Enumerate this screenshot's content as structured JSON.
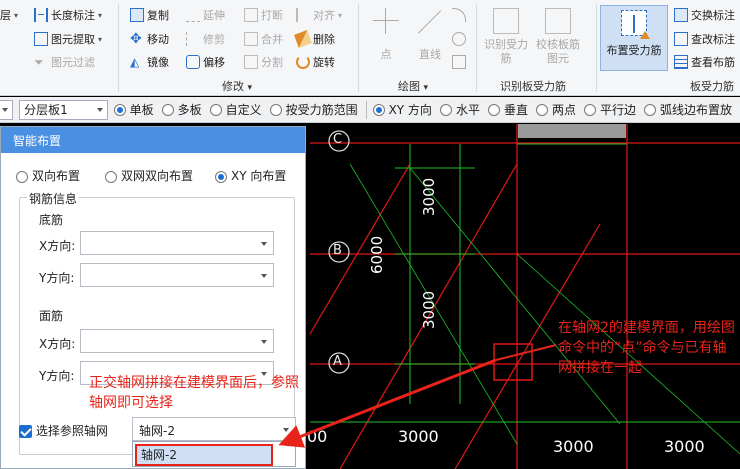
{
  "ribbon": {
    "left_items": [
      "层",
      "长度标注",
      "图元提取",
      "图元过滤"
    ],
    "modify_items": [
      "复制",
      "延伸",
      "打断",
      "对齐",
      "移动",
      "修剪",
      "合并",
      "删除",
      "镜像",
      "偏移",
      "分割",
      "旋转"
    ],
    "modify_label": "修改",
    "draw_items": [
      "点",
      "直线"
    ],
    "draw_label": "绘图",
    "identify_items": [
      "识别受力筋",
      "校核板筋图元"
    ],
    "identify_label": "识别板受力筋",
    "place_button": "布置受力筋",
    "rebar_items": [
      "交换标注",
      "查改标注",
      "查看布筋"
    ],
    "rebar_label": "板受力筋"
  },
  "optbar": {
    "layer_value": "分层板1",
    "options": [
      {
        "label": "单板",
        "selected": true
      },
      {
        "label": "多板",
        "selected": false
      },
      {
        "label": "自定义",
        "selected": false
      },
      {
        "label": "按受力筋范围",
        "selected": false
      },
      {
        "label": "XY 方向",
        "selected": true
      },
      {
        "label": "水平",
        "selected": false
      },
      {
        "label": "垂直",
        "selected": false
      },
      {
        "label": "两点",
        "selected": false
      },
      {
        "label": "平行边",
        "selected": false
      },
      {
        "label": "弧线边布置放",
        "selected": false
      }
    ]
  },
  "panel": {
    "title": "智能布置",
    "mode_options": [
      {
        "label": "双向布置",
        "selected": false
      },
      {
        "label": "双网双向布置",
        "selected": false
      },
      {
        "label": "XY 向布置",
        "selected": true
      }
    ],
    "rebar_info_label": "钢筋信息",
    "bottom_label": "底筋",
    "top_label": "面筋",
    "x_dir_label": "X方向:",
    "y_dir_label": "Y方向:",
    "ref_axis_checkbox": "选择参照轴网",
    "ref_axis_checked": true,
    "ref_axis_value": "轴网-2",
    "dropdown_option": "轴网-2"
  },
  "cad": {
    "axis_labels": [
      "C",
      "B",
      "A"
    ],
    "dims": [
      "3000",
      "6000",
      "3000",
      "3000",
      "3000",
      "00"
    ]
  },
  "annotations": {
    "left_note": "正交轴网拼接在建模界面后，参照轴网即可选择",
    "right_note": "在轴网2的建模界面，用绘图命令中的“点”命令与已有轴网拼接在一起"
  },
  "colors": {
    "accent": "#4a90e2",
    "annotation_red": "#e8231a",
    "cad_green": "#1fbf2a",
    "cad_red": "#e01818"
  }
}
